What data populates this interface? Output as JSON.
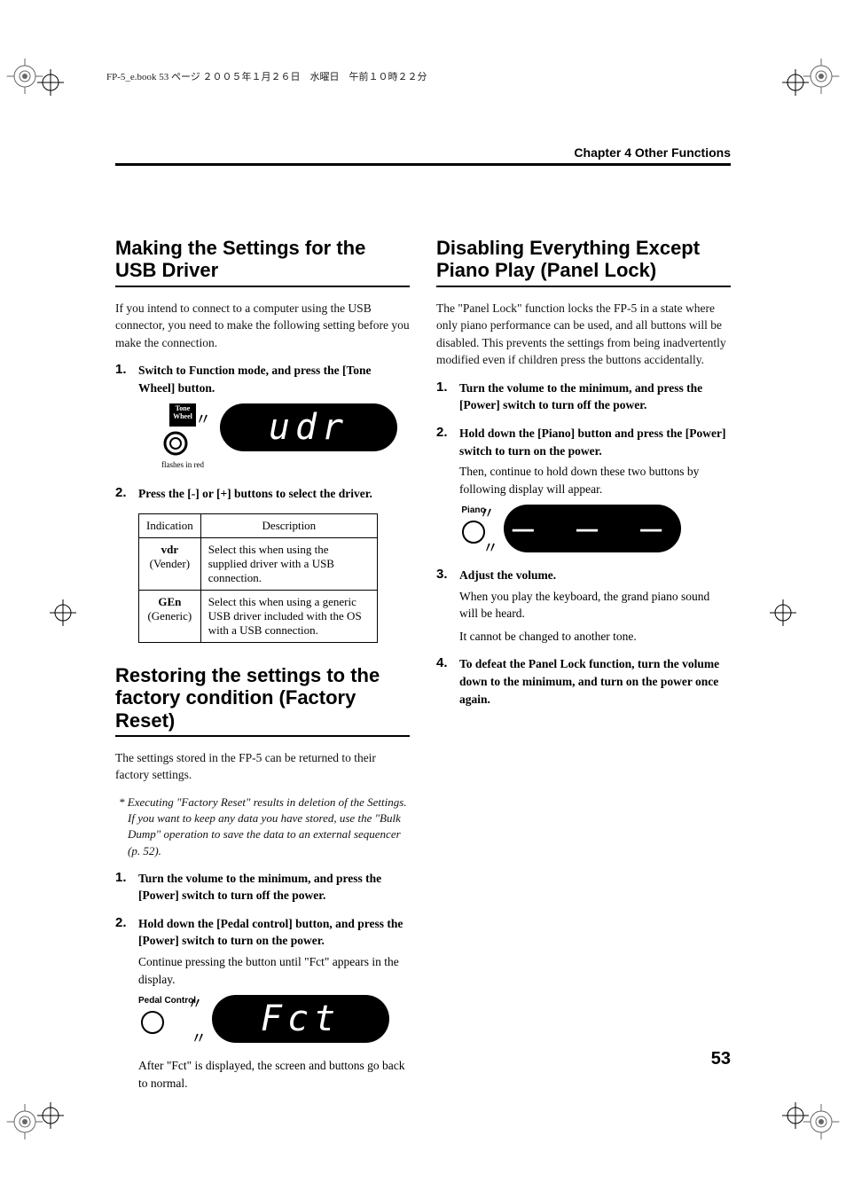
{
  "header_note": "FP-5_e.book 53 ページ ２００５年１月２６日　水曜日　午前１０時２２分",
  "chapter_title": "Chapter 4 Other Functions",
  "page_number": "53",
  "left": {
    "sec1": {
      "title": "Making the Settings for the USB Driver",
      "intro": "If you intend to connect to a computer using the USB connector, you need to make the following setting before you make the connection.",
      "step1": "Switch to Function mode, and press the [Tone Wheel] button.",
      "fig1_label": "Tone\nWheel",
      "fig1_caption": "flashes in red",
      "fig1_display": "udr",
      "step2": "Press the [-] or [+] buttons to select the driver.",
      "table": {
        "h1": "Indication",
        "h2": "Description",
        "r1c1a": "vdr",
        "r1c1b": "(Vender)",
        "r1c2": "Select this when using the supplied driver with a USB connection.",
        "r2c1a": "GEn",
        "r2c1b": "(Generic)",
        "r2c2": "Select this when using a generic USB driver included with the OS with a USB connection."
      }
    },
    "sec2": {
      "title": "Restoring the settings to the factory condition (Factory Reset)",
      "intro": "The settings stored in the FP-5 can be returned to their factory settings.",
      "note": "* Executing \"Factory Reset\" results in deletion of the Settings. If you want to keep any data you have stored, use the \"Bulk Dump\" operation to save the data to an external sequencer (p. 52).",
      "step1": "Turn the volume to the minimum, and press the [Power] switch to turn off the power.",
      "step2_main": "Hold down the [Pedal control] button, and press the [Power] switch to turn on the power.",
      "step2_body": "Continue pressing the button until \"Fct\" appears in the display.",
      "fig_label": "Pedal Control",
      "fig_display": "Fct",
      "after": "After \"Fct\" is displayed, the screen and buttons go back to normal."
    }
  },
  "right": {
    "sec1": {
      "title": "Disabling Everything Except Piano Play (Panel Lock)",
      "intro": "The \"Panel Lock\" function locks the FP-5 in a state where only piano performance can be used, and all buttons will be disabled. This prevents the settings from being inadvertently modified even if children press the buttons accidentally.",
      "step1": "Turn the volume to the minimum, and press the [Power] switch to turn off the power.",
      "step2_main": "Hold down the [Piano] button and press the [Power] switch to turn on the power.",
      "step2_body": "Then, continue to hold down these two buttons by following display will appear.",
      "fig_label": "Piano",
      "fig_display": "– – –",
      "step3_main": "Adjust the volume.",
      "step3_b1": "When you play the keyboard, the grand piano sound will be heard.",
      "step3_b2": "It cannot be changed to another tone.",
      "step4": "To defeat the Panel Lock function, turn the volume down to the minimum, and turn on the power once again."
    }
  }
}
